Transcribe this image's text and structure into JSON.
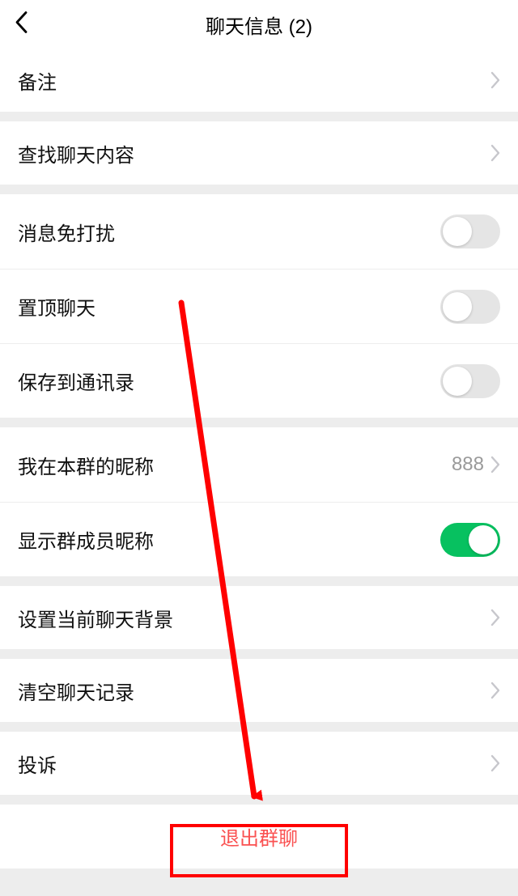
{
  "header": {
    "title": "聊天信息 (2)"
  },
  "rows": {
    "remark": "备注",
    "search": "查找聊天内容",
    "mute": "消息免打扰",
    "pin": "置顶聊天",
    "save": "保存到通讯录",
    "nickname_label": "我在本群的昵称",
    "nickname_value": "888",
    "show_member_nick": "显示群成员昵称",
    "set_bg": "设置当前聊天背景",
    "clear": "清空聊天记录",
    "report": "投诉",
    "leave": "退出群聊"
  },
  "toggles": {
    "mute": false,
    "pin": false,
    "save": false,
    "show_member_nick": true
  },
  "colors": {
    "accent_green": "#07c160",
    "danger": "#fa5151",
    "highlight": "#ff0000"
  }
}
